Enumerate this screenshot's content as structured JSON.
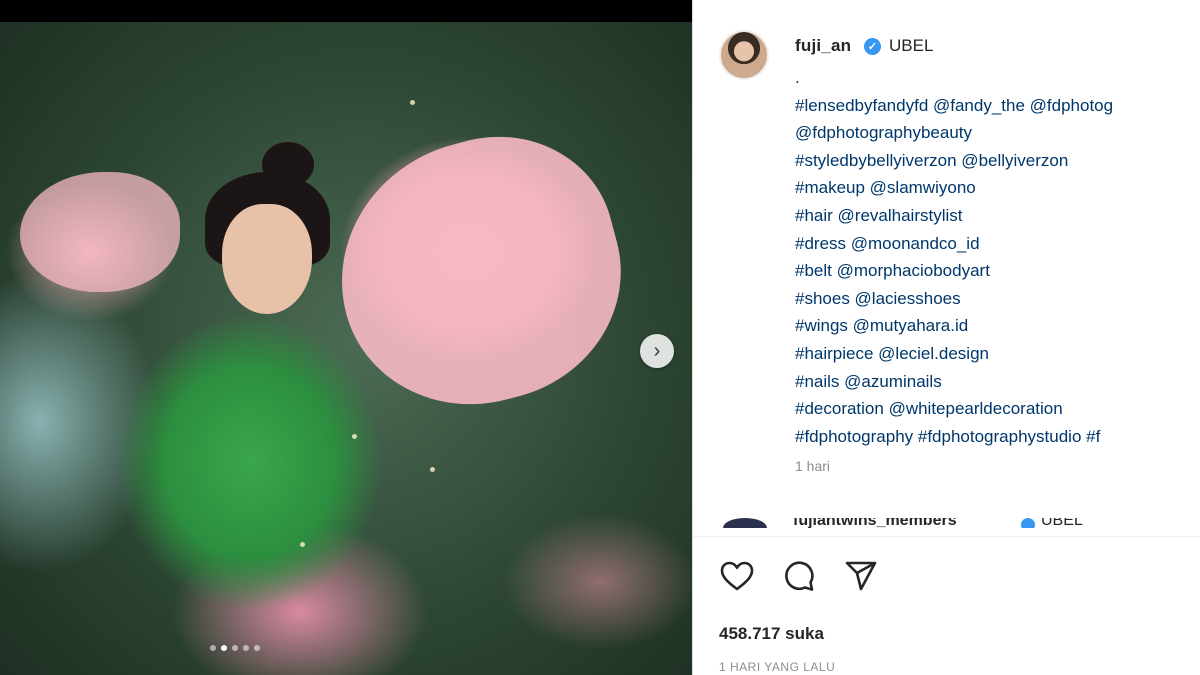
{
  "post": {
    "username": "fuji_an",
    "location": "UBEL",
    "caption_lines": [
      ".",
      "#lensedbyfandyfd @fandy_the @fdphotog",
      "@fdphotographybeauty",
      "#styledbybellyiverzon @bellyiverzon",
      "#makeup @slamwiyono",
      "#hair @revalhairstylist",
      "#dress @moonandco_id",
      "#belt @morphaciobodyart",
      "#shoes @laciesshoes",
      "#wings @mutyahara.id",
      "#hairpiece @leciel.design",
      "#nails @azuminails",
      "#decoration @whitepearldecoration",
      "#fdphotography #fdphotographystudio #f"
    ],
    "caption_time": "1 hari",
    "next_comment": {
      "username": "fujiantwins_members",
      "location": "UBEL"
    },
    "likes": "458.717 suka",
    "posted_ago": "1 HARI YANG LALU"
  },
  "icons": {
    "like": "heart-icon",
    "comment": "comment-icon",
    "share": "share-icon",
    "next": "chevron-right-icon",
    "verified": "verified-badge-icon"
  },
  "carousel": {
    "dot_count": 5,
    "active_index": 1
  },
  "colors": {
    "verified": "#3897f0",
    "link": "#00376b",
    "text": "#262626",
    "muted": "#8e8e8e"
  }
}
